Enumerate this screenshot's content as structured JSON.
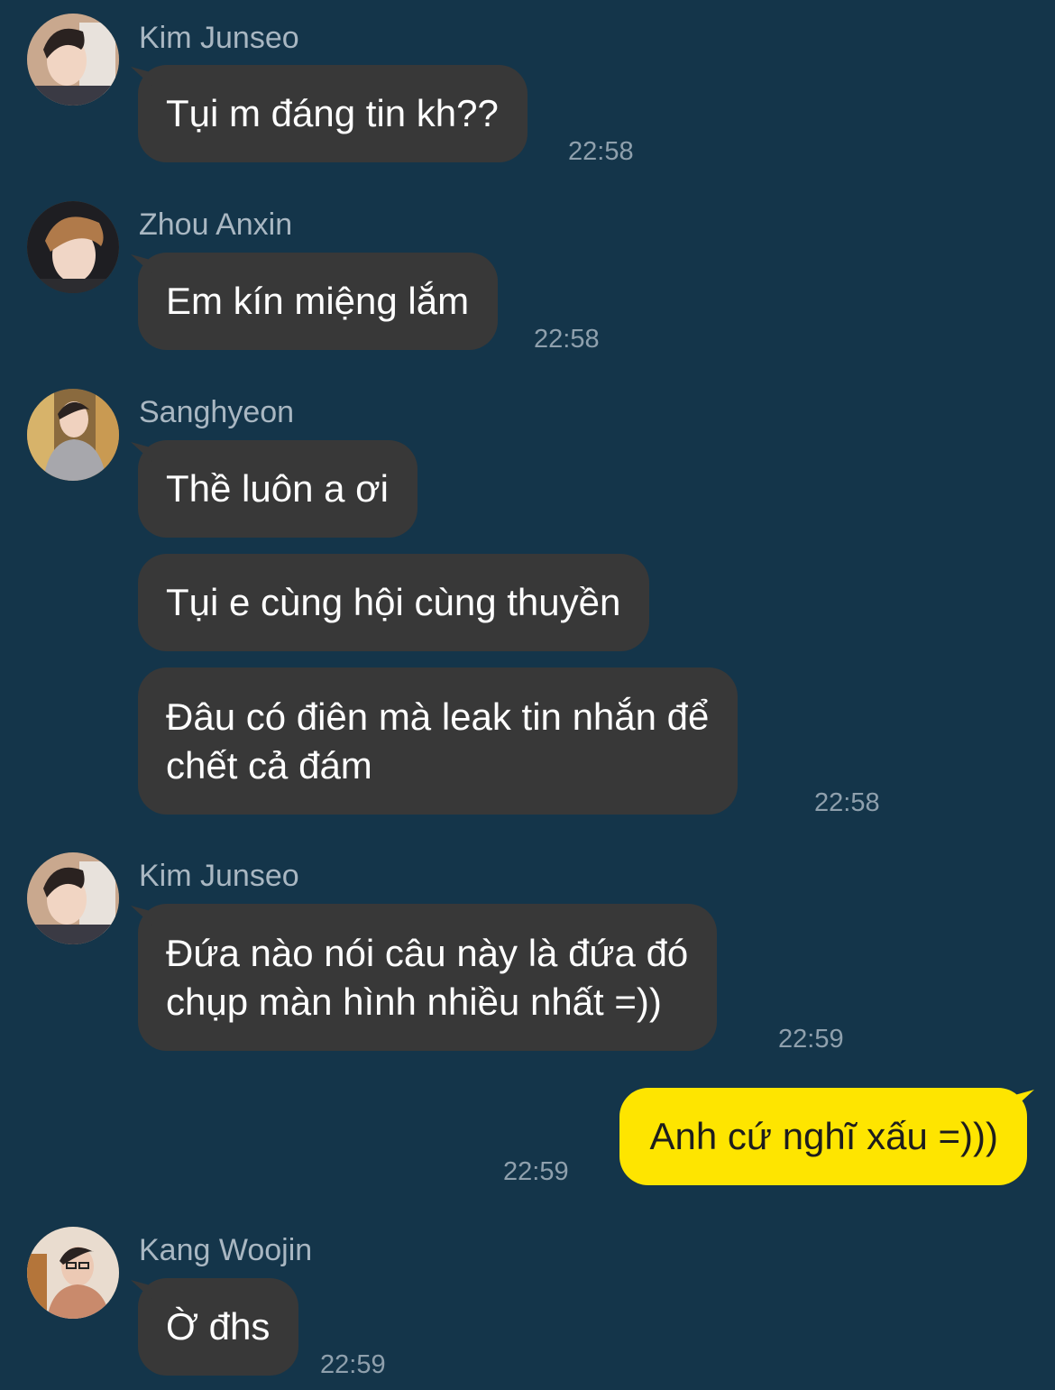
{
  "colors": {
    "background": "#14354a",
    "incoming_bubble": "#383838",
    "outgoing_bubble": "#fee500",
    "sender_name": "#a9b7c2",
    "timestamp": "#8fa0ad"
  },
  "messages": [
    {
      "sender": "Kim Junseo",
      "avatar_icon": "profile-photo-icon",
      "bubbles": [
        "Tụi m đáng tin kh??"
      ],
      "time": "22:58"
    },
    {
      "sender": "Zhou Anxin",
      "avatar_icon": "profile-photo-icon",
      "bubbles": [
        "Em kín miệng lắm"
      ],
      "time": "22:58"
    },
    {
      "sender": "Sanghyeon",
      "avatar_icon": "profile-photo-icon",
      "bubbles": [
        "Thề luôn a ơi",
        "Tụi e cùng hội cùng thuyền",
        "Đâu có điên mà leak tin nhắn để",
        "chết cả đám"
      ],
      "time": "22:58"
    },
    {
      "sender": "Kim Junseo",
      "avatar_icon": "profile-photo-icon",
      "bubbles": [
        "Đứa nào nói câu này là đứa đó",
        "chụp màn hình nhiều nhất =))"
      ],
      "time": "22:59"
    },
    {
      "sender": "me",
      "bubbles": [
        "Anh cứ nghĩ xấu =)))"
      ],
      "time": "22:59"
    },
    {
      "sender": "Kang Woojin",
      "avatar_icon": "profile-photo-icon",
      "bubbles": [
        "Ờ đhs"
      ],
      "time": "22:59"
    }
  ]
}
